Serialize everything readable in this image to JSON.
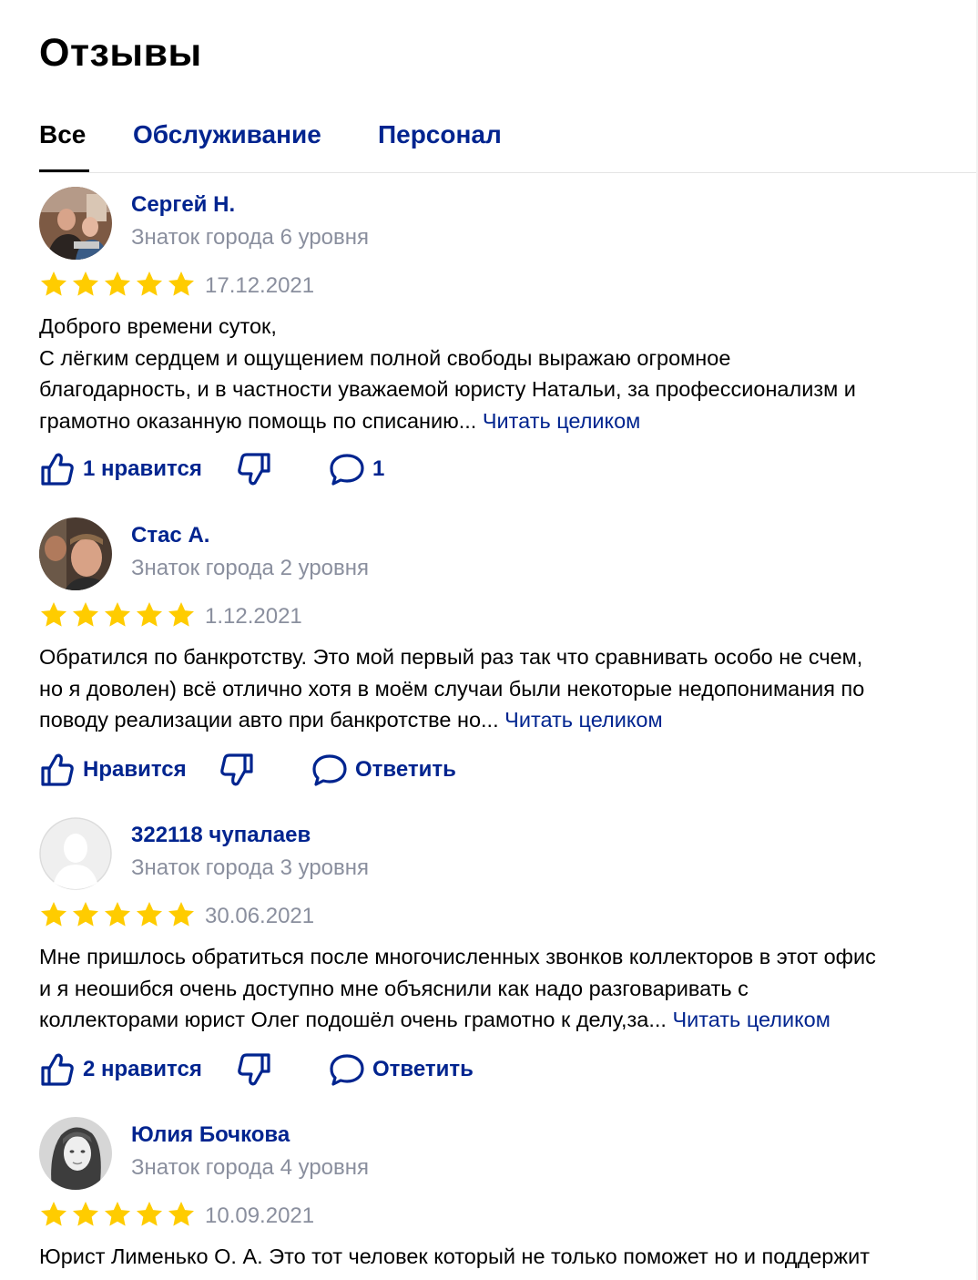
{
  "header": {
    "title": "Отзывы"
  },
  "tabs": [
    {
      "label": "Все",
      "active": true
    },
    {
      "label": "Обслуживание",
      "active": false
    },
    {
      "label": "Персонал",
      "active": false
    }
  ],
  "colors": {
    "link": "#00248f",
    "star": "#fc0",
    "muted": "#8a8f9e"
  },
  "reviews": [
    {
      "author": "Сергей Н.",
      "level": "Знаток города 6 уровня",
      "rating": 5,
      "date": "17.12.2021",
      "lines": [
        "Доброго времени суток,",
        "С лёгким сердцем и ощущением полной свободы выражаю огромное",
        "благодарность, и в частности уважаемой юристу Натальи, за профессионализм и",
        "грамотно оказанную помощь по списанию..."
      ],
      "read_more": "Читать целиком",
      "like_label": "1 нравится",
      "comment_label": "1"
    },
    {
      "author": "Стас А.",
      "level": "Знаток города 2 уровня",
      "rating": 5,
      "date": "1.12.2021",
      "lines": [
        "Обратился по банкротству. Это мой первый раз так что сравнивать особо не счем,",
        "но я доволен) всё отлично хотя в моём случаи были некоторые недопонимания по",
        "поводу реализации авто при банкротстве но..."
      ],
      "read_more": "Читать целиком",
      "like_label": "Нравится",
      "comment_label": "Ответить"
    },
    {
      "author": "322118 чупалаев",
      "level": "Знаток города 3 уровня",
      "rating": 5,
      "date": "30.06.2021",
      "lines": [
        "Мне пришлось обратиться после многочисленных звонков коллекторов в этот офис",
        "и я неошибся очень доступно мне объяснили как надо разговаривать с",
        "коллекторами юрист Олег подошёл очень грамотно к делу,за..."
      ],
      "read_more": "Читать целиком",
      "like_label": "2 нравится",
      "comment_label": "Ответить"
    },
    {
      "author": "Юлия Бочкова",
      "level": "Знаток города 4 уровня",
      "rating": 5,
      "date": "10.09.2021",
      "lines": [
        "Юрист Лименько О. А. Это тот человек который не только поможет но и поддержит"
      ],
      "read_more": "",
      "like_label": "",
      "comment_label": ""
    }
  ]
}
